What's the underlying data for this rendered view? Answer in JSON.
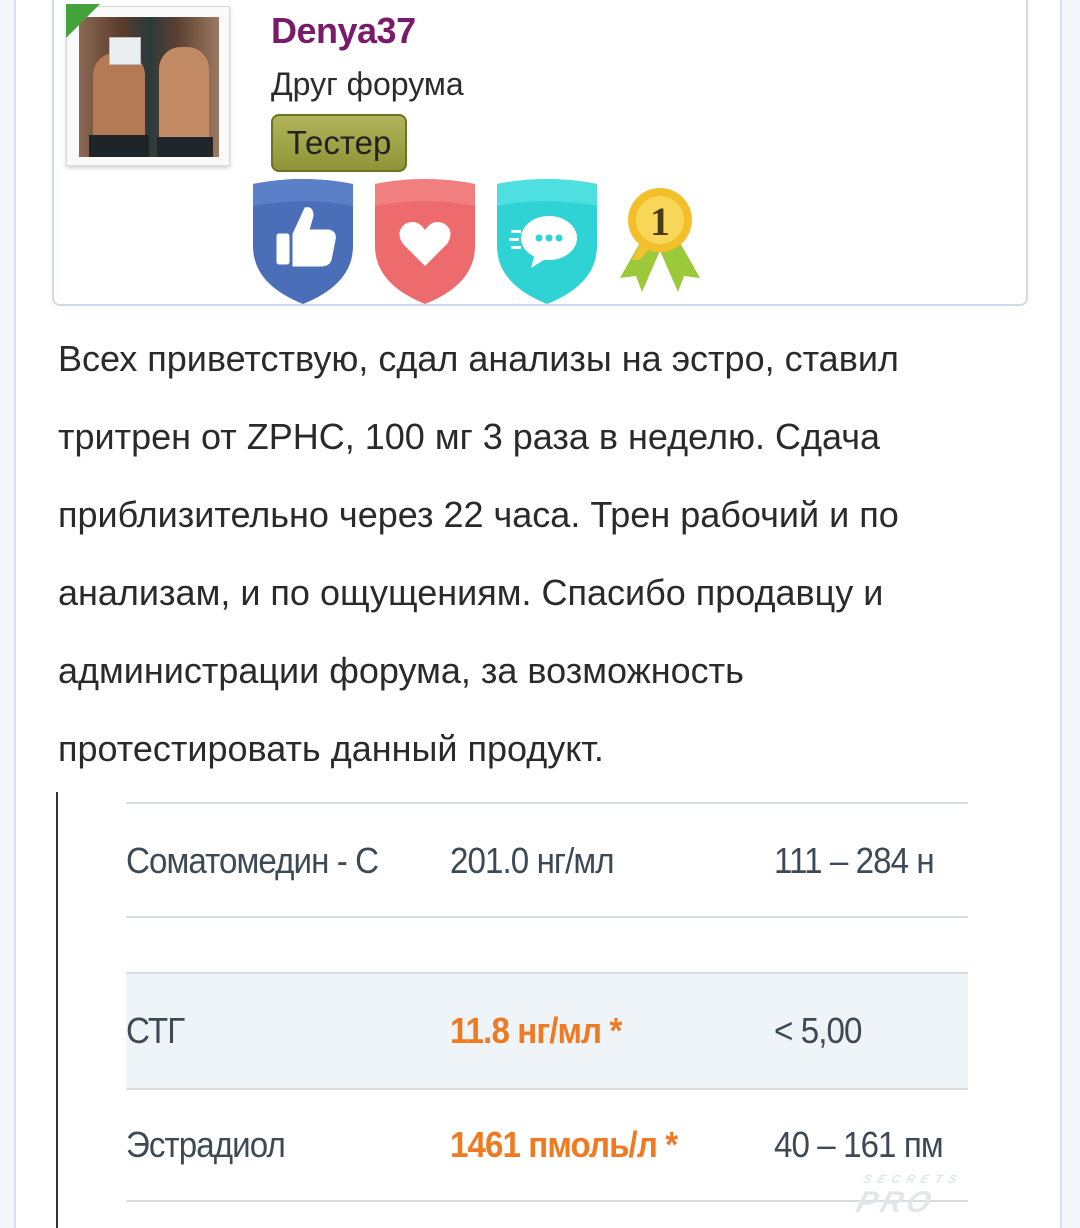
{
  "user": {
    "name": "Denya37",
    "rank": "Друг форума",
    "badge": "Тестер",
    "awards": [
      {
        "icon": "thumbs-up-icon",
        "color": "#4a6fb8"
      },
      {
        "icon": "heart-icon",
        "color": "#ee6b6d"
      },
      {
        "icon": "chat-bubble-icon",
        "color": "#2fd3d3"
      },
      {
        "icon": "medal-icon",
        "label": "1"
      }
    ]
  },
  "post": {
    "lines": [
      "Всех приветствую, сдал анализы на эстро, ставил",
      "тритрен от ZPHC, 100 мг 3 раза в неделю. Сдача",
      "приблизительно через 22 часа. Трен рабочий и по",
      "анализам, и по ощущениям. Спасибо продавцу и",
      "администрации форума, за возможность",
      "протестировать данный продукт."
    ]
  },
  "lab_results": {
    "rows": [
      {
        "name": "Соматомедин - С",
        "value": "201.0 нг/мл",
        "ref": "111 – 284 н",
        "flag": false
      },
      {
        "name": "СТГ",
        "value": "11.8 нг/мл *",
        "ref": "< 5,00",
        "flag": true
      },
      {
        "name": "Эстрадиол",
        "value": "1461 пмоль/л *",
        "ref": "40 – 161 пм",
        "flag": true
      }
    ],
    "watermark_top": "SECRETS",
    "watermark_main": "PRO"
  }
}
